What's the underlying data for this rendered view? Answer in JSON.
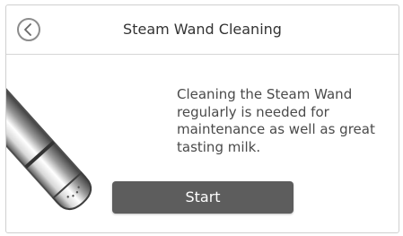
{
  "header": {
    "title": "Steam Wand Cleaning",
    "back_icon": "chevron-left-icon"
  },
  "illustration": {
    "icon": "steam-wand-icon"
  },
  "main": {
    "message": "Cleaning the Steam Wand\nregularly is needed for\nmaintenance as well as great\ntasting milk.",
    "start_label": "Start"
  },
  "colors": {
    "button_bg": "#5d5d5d",
    "button_text": "#ffffff",
    "text": "#4a4a4a"
  }
}
